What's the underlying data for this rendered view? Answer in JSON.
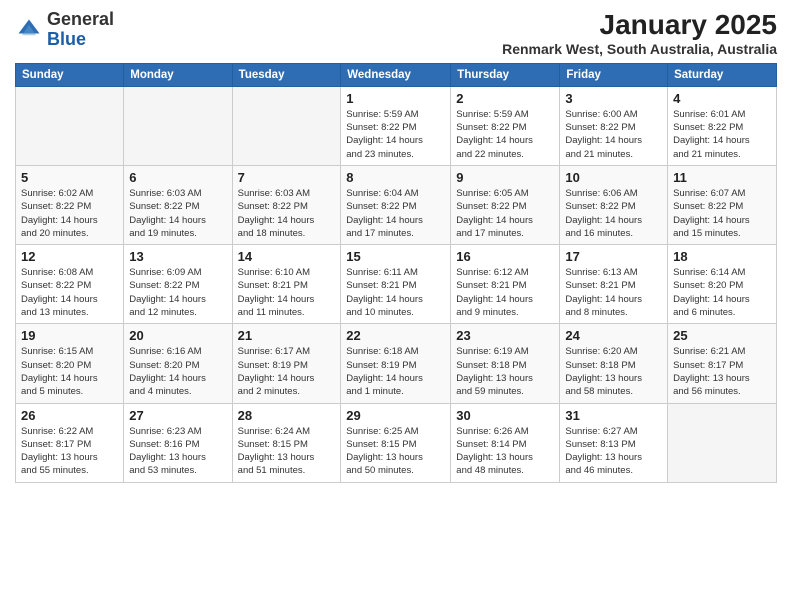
{
  "logo": {
    "general": "General",
    "blue": "Blue"
  },
  "title": "January 2025",
  "subtitle": "Renmark West, South Australia, Australia",
  "days_of_week": [
    "Sunday",
    "Monday",
    "Tuesday",
    "Wednesday",
    "Thursday",
    "Friday",
    "Saturday"
  ],
  "weeks": [
    [
      {
        "day": "",
        "info": ""
      },
      {
        "day": "",
        "info": ""
      },
      {
        "day": "",
        "info": ""
      },
      {
        "day": "1",
        "info": "Sunrise: 5:59 AM\nSunset: 8:22 PM\nDaylight: 14 hours\nand 23 minutes."
      },
      {
        "day": "2",
        "info": "Sunrise: 5:59 AM\nSunset: 8:22 PM\nDaylight: 14 hours\nand 22 minutes."
      },
      {
        "day": "3",
        "info": "Sunrise: 6:00 AM\nSunset: 8:22 PM\nDaylight: 14 hours\nand 21 minutes."
      },
      {
        "day": "4",
        "info": "Sunrise: 6:01 AM\nSunset: 8:22 PM\nDaylight: 14 hours\nand 21 minutes."
      }
    ],
    [
      {
        "day": "5",
        "info": "Sunrise: 6:02 AM\nSunset: 8:22 PM\nDaylight: 14 hours\nand 20 minutes."
      },
      {
        "day": "6",
        "info": "Sunrise: 6:03 AM\nSunset: 8:22 PM\nDaylight: 14 hours\nand 19 minutes."
      },
      {
        "day": "7",
        "info": "Sunrise: 6:03 AM\nSunset: 8:22 PM\nDaylight: 14 hours\nand 18 minutes."
      },
      {
        "day": "8",
        "info": "Sunrise: 6:04 AM\nSunset: 8:22 PM\nDaylight: 14 hours\nand 17 minutes."
      },
      {
        "day": "9",
        "info": "Sunrise: 6:05 AM\nSunset: 8:22 PM\nDaylight: 14 hours\nand 17 minutes."
      },
      {
        "day": "10",
        "info": "Sunrise: 6:06 AM\nSunset: 8:22 PM\nDaylight: 14 hours\nand 16 minutes."
      },
      {
        "day": "11",
        "info": "Sunrise: 6:07 AM\nSunset: 8:22 PM\nDaylight: 14 hours\nand 15 minutes."
      }
    ],
    [
      {
        "day": "12",
        "info": "Sunrise: 6:08 AM\nSunset: 8:22 PM\nDaylight: 14 hours\nand 13 minutes."
      },
      {
        "day": "13",
        "info": "Sunrise: 6:09 AM\nSunset: 8:22 PM\nDaylight: 14 hours\nand 12 minutes."
      },
      {
        "day": "14",
        "info": "Sunrise: 6:10 AM\nSunset: 8:21 PM\nDaylight: 14 hours\nand 11 minutes."
      },
      {
        "day": "15",
        "info": "Sunrise: 6:11 AM\nSunset: 8:21 PM\nDaylight: 14 hours\nand 10 minutes."
      },
      {
        "day": "16",
        "info": "Sunrise: 6:12 AM\nSunset: 8:21 PM\nDaylight: 14 hours\nand 9 minutes."
      },
      {
        "day": "17",
        "info": "Sunrise: 6:13 AM\nSunset: 8:21 PM\nDaylight: 14 hours\nand 8 minutes."
      },
      {
        "day": "18",
        "info": "Sunrise: 6:14 AM\nSunset: 8:20 PM\nDaylight: 14 hours\nand 6 minutes."
      }
    ],
    [
      {
        "day": "19",
        "info": "Sunrise: 6:15 AM\nSunset: 8:20 PM\nDaylight: 14 hours\nand 5 minutes."
      },
      {
        "day": "20",
        "info": "Sunrise: 6:16 AM\nSunset: 8:20 PM\nDaylight: 14 hours\nand 4 minutes."
      },
      {
        "day": "21",
        "info": "Sunrise: 6:17 AM\nSunset: 8:19 PM\nDaylight: 14 hours\nand 2 minutes."
      },
      {
        "day": "22",
        "info": "Sunrise: 6:18 AM\nSunset: 8:19 PM\nDaylight: 14 hours\nand 1 minute."
      },
      {
        "day": "23",
        "info": "Sunrise: 6:19 AM\nSunset: 8:18 PM\nDaylight: 13 hours\nand 59 minutes."
      },
      {
        "day": "24",
        "info": "Sunrise: 6:20 AM\nSunset: 8:18 PM\nDaylight: 13 hours\nand 58 minutes."
      },
      {
        "day": "25",
        "info": "Sunrise: 6:21 AM\nSunset: 8:17 PM\nDaylight: 13 hours\nand 56 minutes."
      }
    ],
    [
      {
        "day": "26",
        "info": "Sunrise: 6:22 AM\nSunset: 8:17 PM\nDaylight: 13 hours\nand 55 minutes."
      },
      {
        "day": "27",
        "info": "Sunrise: 6:23 AM\nSunset: 8:16 PM\nDaylight: 13 hours\nand 53 minutes."
      },
      {
        "day": "28",
        "info": "Sunrise: 6:24 AM\nSunset: 8:15 PM\nDaylight: 13 hours\nand 51 minutes."
      },
      {
        "day": "29",
        "info": "Sunrise: 6:25 AM\nSunset: 8:15 PM\nDaylight: 13 hours\nand 50 minutes."
      },
      {
        "day": "30",
        "info": "Sunrise: 6:26 AM\nSunset: 8:14 PM\nDaylight: 13 hours\nand 48 minutes."
      },
      {
        "day": "31",
        "info": "Sunrise: 6:27 AM\nSunset: 8:13 PM\nDaylight: 13 hours\nand 46 minutes."
      },
      {
        "day": "",
        "info": ""
      }
    ]
  ]
}
